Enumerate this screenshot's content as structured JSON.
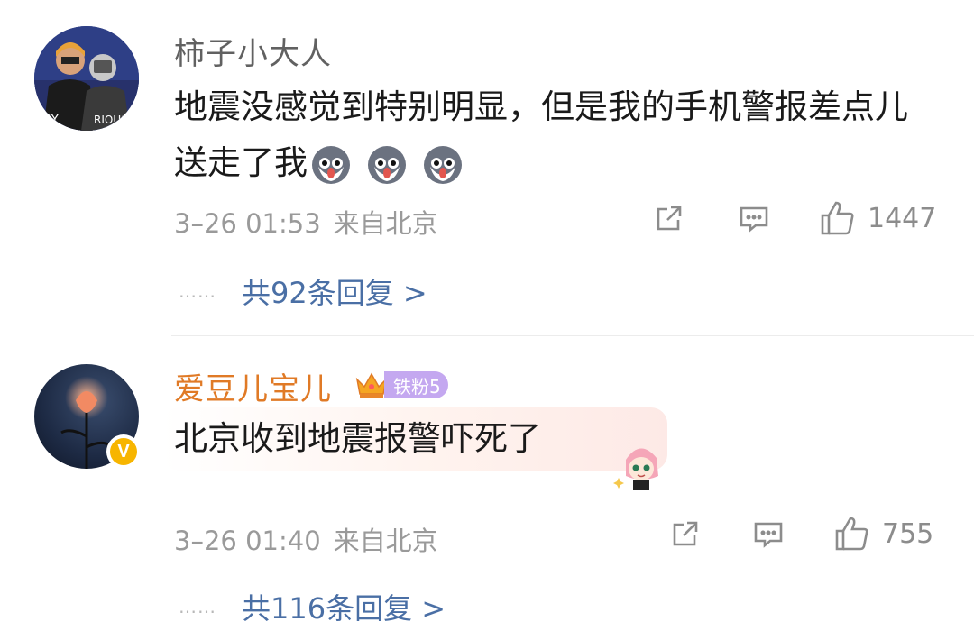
{
  "comments": [
    {
      "username": "柿子小大人",
      "text": "地震没感觉到特别明显，但是我的手机警报差点儿送走了我",
      "emojis": [
        "husky-emoji",
        "husky-emoji",
        "husky-emoji"
      ],
      "date": "3–26 01:53",
      "location": "来自北京",
      "likes": "1447",
      "replies_label": "共92条回复 >",
      "dots": "……"
    },
    {
      "username": "爱豆儿宝儿",
      "badge": "铁粉5",
      "verified": "V",
      "text": "北京收到地震报警吓死了",
      "date": "3–26 01:40",
      "location": "来自北京",
      "likes": "755",
      "replies_label": "共116条回复 >",
      "dots": "……"
    }
  ],
  "colors": {
    "username_gray": "#616161",
    "username_fan": "#e07a26",
    "reply_link": "#4a6fa5",
    "meta_gray": "#9a9a9a",
    "badge_purple": "#c4a8f0",
    "verified_yellow": "#f7b500"
  }
}
